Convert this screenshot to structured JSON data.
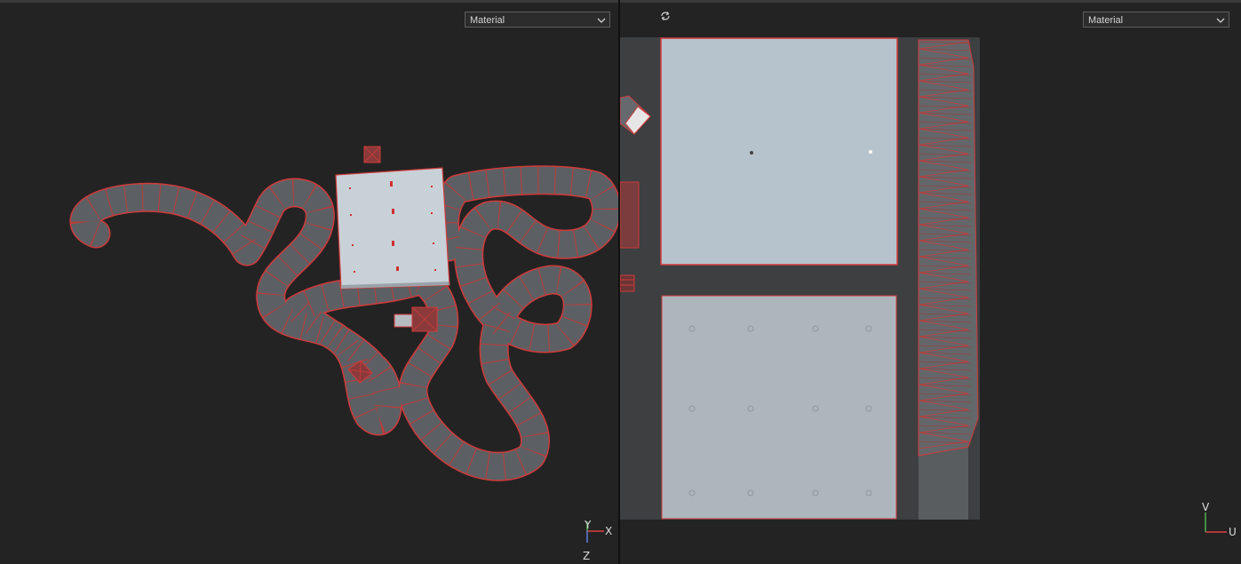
{
  "viewports": {
    "left": {
      "shading_mode": "Material",
      "gizmo": {
        "axis_y": "Y",
        "axis_x": "X",
        "axis_z": "Z"
      }
    },
    "right": {
      "shading_mode": "Material",
      "gizmo": {
        "axis_v": "V",
        "axis_u": "U"
      }
    }
  },
  "icons": {
    "dropdown": "chevron-down-icon",
    "sync": "sync-icon"
  },
  "colors": {
    "background": "#232323",
    "wire": "#d23a3a",
    "road": "#5c6064",
    "ground_plate": "#c4ced6",
    "axis_x": "#e04040",
    "axis_y": "#50b050"
  }
}
